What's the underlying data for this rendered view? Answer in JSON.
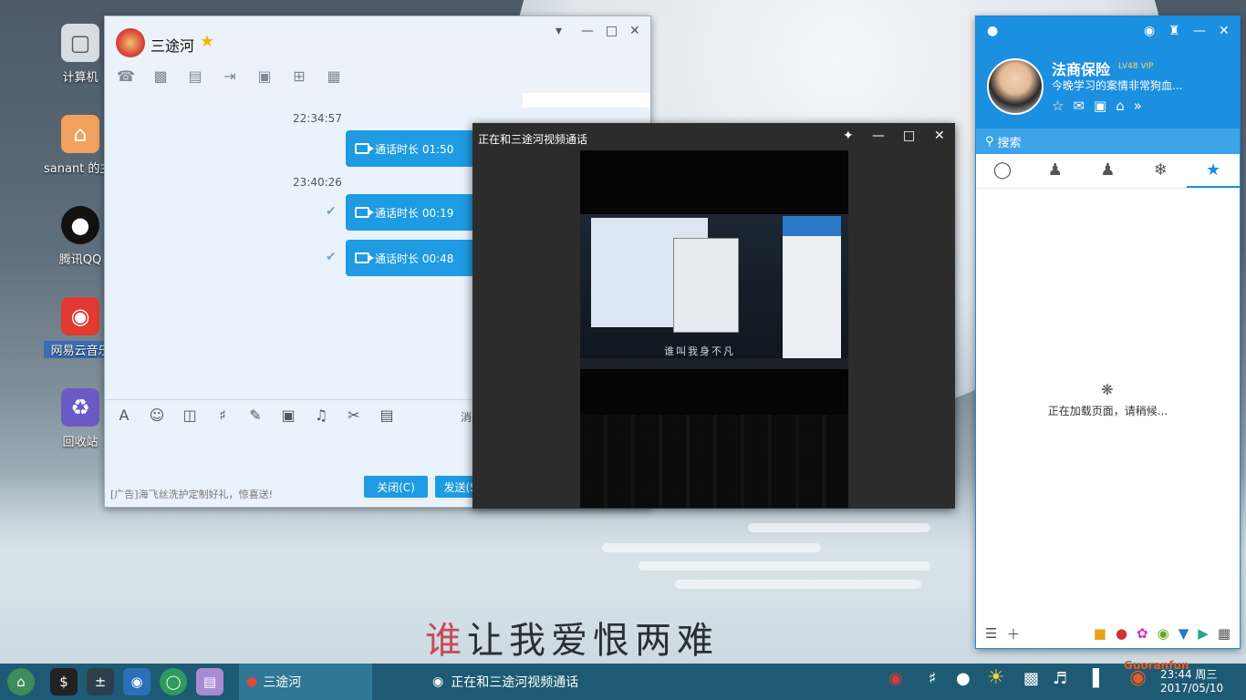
{
  "desktop": {
    "icons": [
      {
        "label": "计算机",
        "icon": "computer-icon"
      },
      {
        "label": "sanant 的主文",
        "icon": "home-folder-icon"
      },
      {
        "label": "腾讯QQ",
        "icon": "qq-penguin-icon"
      },
      {
        "label": "网易云音乐",
        "icon": "netease-music-icon"
      },
      {
        "label": "回收站",
        "icon": "recycle-bin-icon"
      }
    ],
    "wallpaper_text": "谁让我爱恨两难"
  },
  "chat_window": {
    "title": "三途河",
    "messages": [
      {
        "time": "22:34:57",
        "text": "通话时长 01:50"
      },
      {
        "time": "23:40:26",
        "text": "通话时长 00:19"
      },
      {
        "time": "",
        "text": "通话时长 00:48"
      }
    ],
    "message_record_label": "消息",
    "ad_text": "[广告]海飞丝洗护定制好礼，惊喜送!",
    "close_button": "关闭(C)",
    "send_button": "发送(S)"
  },
  "video_window": {
    "title": "正在和三途河视频通话",
    "feed_caption": "谁叫我身不凡"
  },
  "qq_panel": {
    "nickname": "法商保险",
    "level_badge": "LV48 VIP",
    "signature": "今晚学习的案情非常狗血...",
    "search_placeholder": "搜索",
    "tabs": [
      "消息",
      "联系人",
      "群",
      "空间",
      "收藏"
    ],
    "loading_text": "正在加载页面，请稍候..."
  },
  "taskbar": {
    "tasks": [
      "三途河",
      "正在和三途河视频通话"
    ],
    "clock_time": "23:44 周三",
    "clock_date": "2017/05/10",
    "watermark": "Guoranfun"
  },
  "colors": {
    "qq_blue": "#1b8fe0",
    "bubble_blue": "#1e9be3",
    "taskbar": "#1d5a74"
  }
}
